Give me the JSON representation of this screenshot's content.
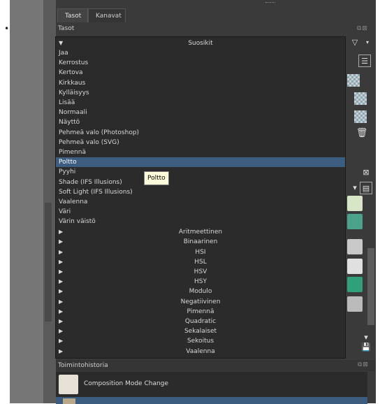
{
  "tabs": [
    {
      "label": "Tasot",
      "active": true
    },
    {
      "label": "Kanavat",
      "active": false
    }
  ],
  "panel_title": "Tasot",
  "dropdown": {
    "favorites_header": "Suosikit",
    "items": [
      "Jaa",
      "Kerrostus",
      "Kertova",
      "Kirkkaus",
      "Kylläisyys",
      "Lisää",
      "Normaali",
      "Näyttö",
      "Pehmeä valo (Photoshop)",
      "Pehmeä valo (SVG)",
      "Pimennä",
      "Poltto",
      "Pyyhi",
      "Shade (IFS Illusions)",
      "Soft Light (IFS Illusions)",
      "Vaalenna",
      "Väri",
      "Värin väistö"
    ],
    "selected": "Poltto",
    "categories": [
      "Aritmeettinen",
      "Binaarinen",
      "HSI",
      "HSL",
      "HSV",
      "HSY",
      "Modulo",
      "Negatiivinen",
      "Pimennä",
      "Quadratic",
      "Sekalaiset",
      "Sekoitus",
      "Vaalenna"
    ]
  },
  "tooltip": "Poltto",
  "history": {
    "title": "Toimintohistoria",
    "items": [
      "Composition Mode Change"
    ]
  },
  "colors": {
    "selection": "#3c5d80",
    "tooltip_bg": "#ffffdc",
    "panel_bg": "#3a3a3a",
    "list_bg": "#2b2b2b"
  }
}
